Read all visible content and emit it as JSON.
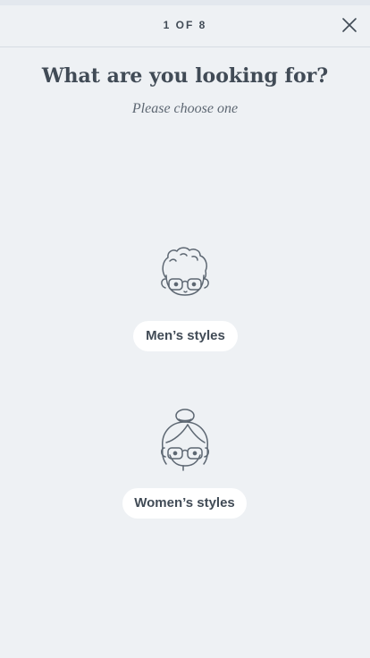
{
  "header": {
    "step_label": "1 OF 8",
    "close_icon": "close-icon"
  },
  "main": {
    "title": "What are you looking for?",
    "subtitle": "Please choose one",
    "choices": [
      {
        "label": "Men’s styles",
        "icon": "man-face-icon"
      },
      {
        "label": "Women’s styles",
        "icon": "woman-face-icon"
      }
    ]
  },
  "colors": {
    "background": "#eef1f4",
    "text": "#414b56",
    "button_bg": "#ffffff",
    "divider": "#d6dce3"
  }
}
